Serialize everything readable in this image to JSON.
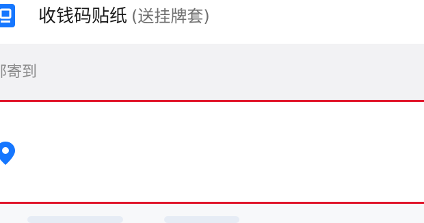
{
  "product": {
    "icon": "document-icon",
    "title": "收钱码贴纸",
    "subtitle": "(送挂牌套)"
  },
  "shipping": {
    "label": "邮寄到"
  },
  "address": {
    "icon": "location-pin-icon"
  },
  "colors": {
    "accent_blue": "#1677ff",
    "highlight_red": "#e0162b",
    "section_gray": "#f2f2f4"
  }
}
